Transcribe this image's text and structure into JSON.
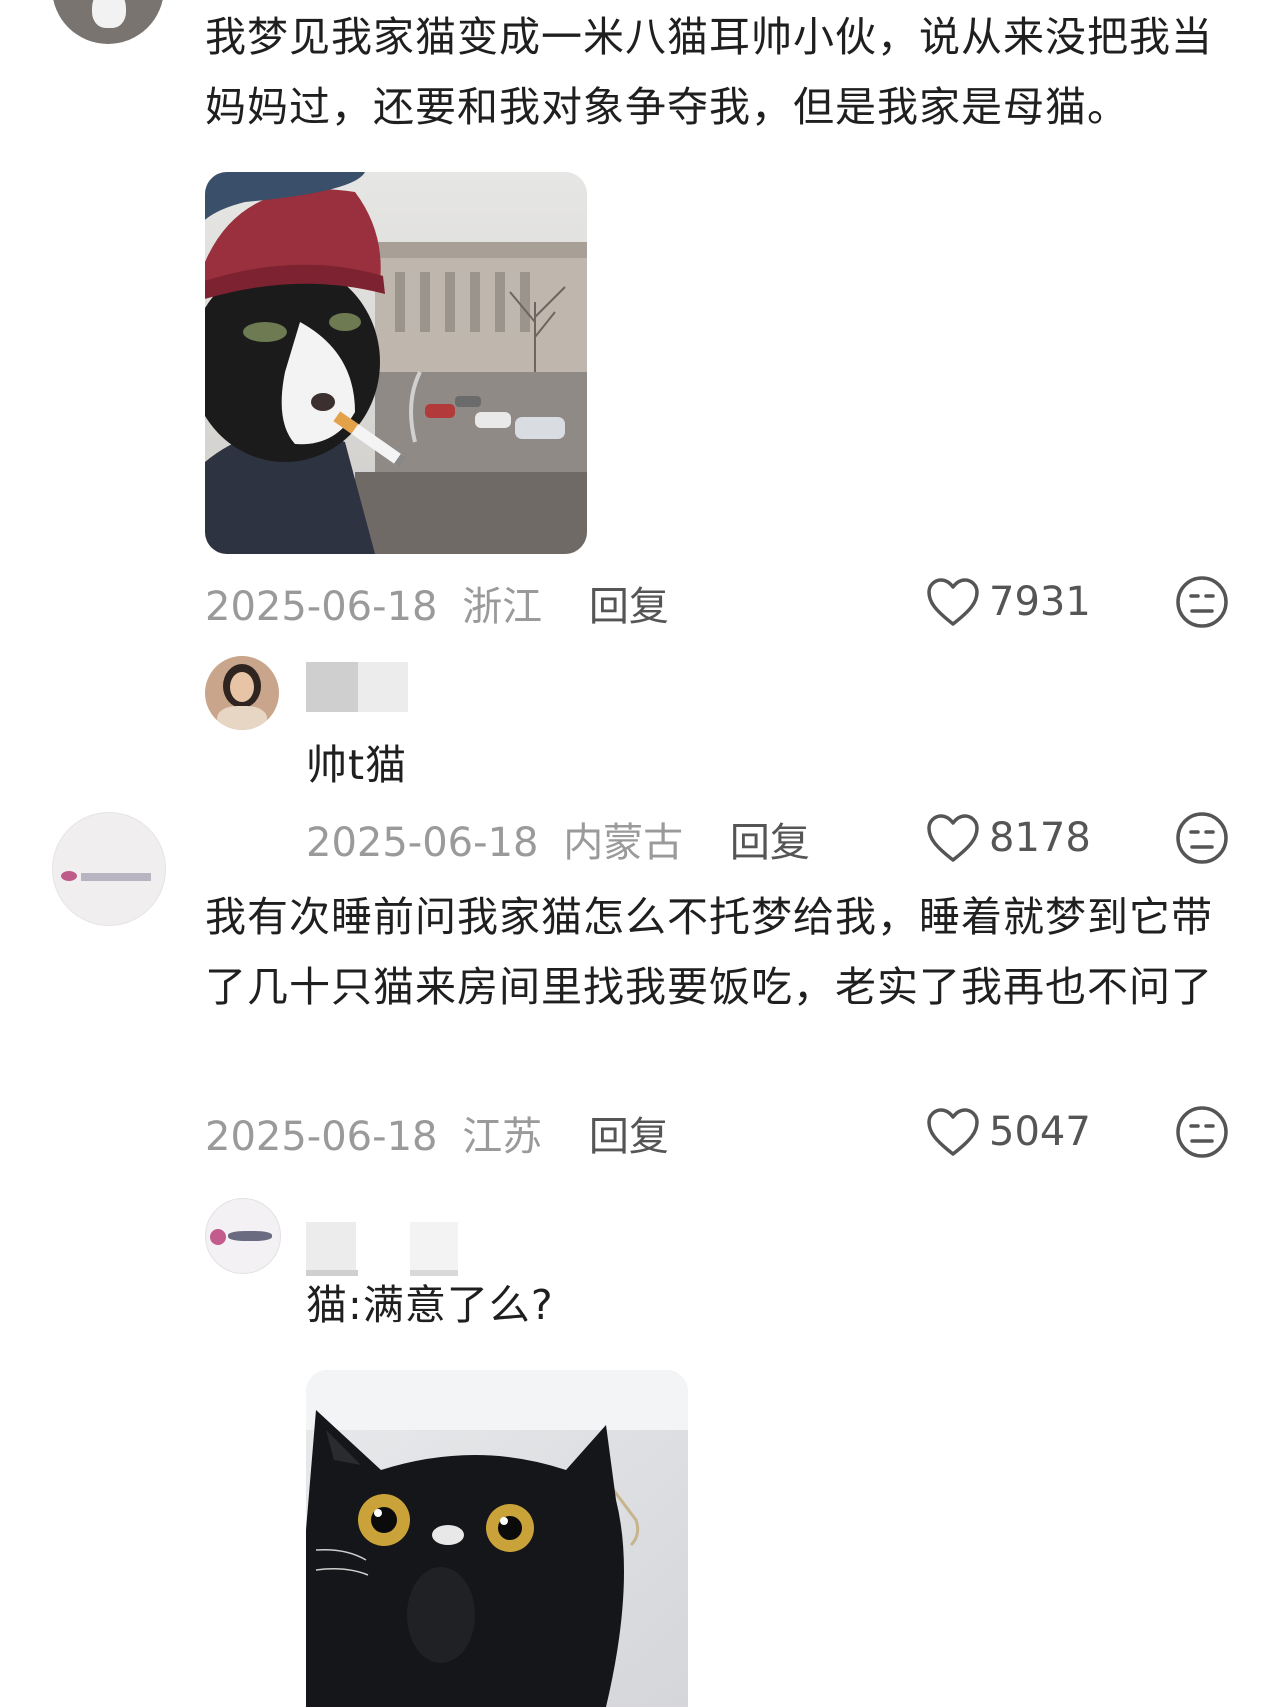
{
  "comments": [
    {
      "text": "我梦见我家猫变成一米八猫耳帅小伙，说从来没把我当妈妈过，还要和我对象争夺我，但是我家是母猫。",
      "date": "2025-06-18",
      "location": "浙江",
      "reply_label": "回复",
      "likes": "7931",
      "reply": {
        "text": "帅t猫",
        "date": "2025-06-18",
        "location": "内蒙古",
        "reply_label": "回复",
        "likes": "8178"
      }
    },
    {
      "text": "我有次睡前问我家猫怎么不托梦给我，睡着就梦到它带了几十只猫来房间里找我要饭吃，老实了我再也不问了",
      "date": "2025-06-18",
      "location": "江苏",
      "reply_label": "回复",
      "likes": "5047",
      "reply": {
        "text": "猫:满意了么?"
      }
    }
  ],
  "icons": {
    "like": "heart-outline-icon",
    "emoji": "neutral-face-icon"
  },
  "colors": {
    "text": "#1f1f1f",
    "meta": "#9a9a9a",
    "icon": "#555555"
  }
}
